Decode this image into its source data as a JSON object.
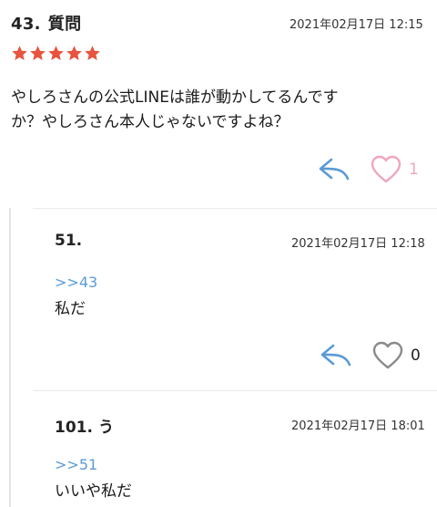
{
  "post": {
    "number": "43.",
    "title": "質問",
    "date": "2021年02月17日 12:15",
    "rating": 5,
    "body_line1": "やしろさんの公式LINEは誰が動かしてるんです",
    "body_line2": "か？やしろさん本人じゃないですよね？",
    "like_count": "1",
    "colors": {
      "star": "#e8533f",
      "reply": "#5b9bd5",
      "heart_liked": "#f0a6bd",
      "heart": "#8a8a8a"
    }
  },
  "replies": [
    {
      "number": "51.",
      "name": "",
      "date": "2021年02月17日 12:18",
      "anchor": ">>43",
      "text": "私だ",
      "like_count": "0"
    },
    {
      "number": "101.",
      "name": "う",
      "date": "2021年02月17日 18:01",
      "anchor": ">>51",
      "text": "いいや私だ"
    }
  ]
}
